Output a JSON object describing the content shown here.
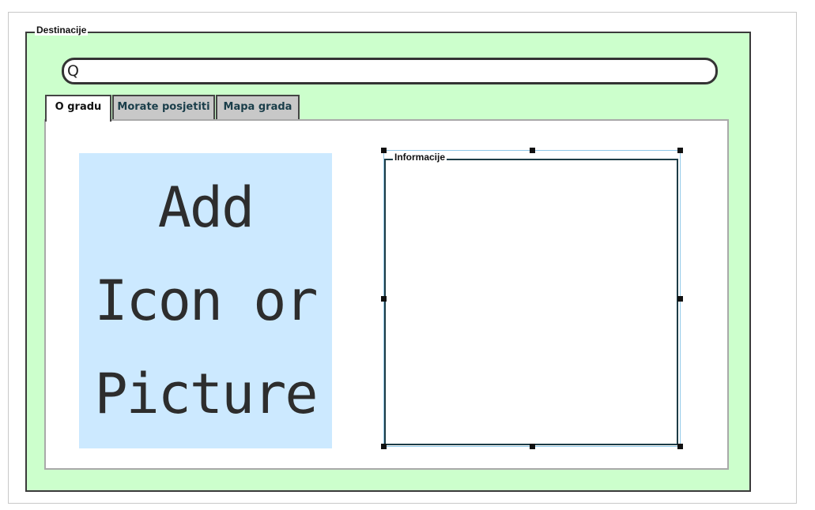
{
  "group": {
    "title": "Destinacije"
  },
  "search": {
    "icon": "search-icon",
    "glyph": "Q",
    "value": ""
  },
  "tabs": [
    {
      "label": "O gradu",
      "active": true
    },
    {
      "label": "Morate posjetiti",
      "active": false
    },
    {
      "label": "Mapa grada",
      "active": false
    }
  ],
  "image_placeholder": {
    "lines": [
      "Add",
      "Icon or",
      "Picture"
    ]
  },
  "info_panel": {
    "title": "Informacije"
  },
  "colors": {
    "group_background": "#ccffcc",
    "image_placeholder_background": "#cce9ff",
    "inactive_tab": "#c8c8c8",
    "info_border": "#1d3c46",
    "selection_outline": "#90c8e8"
  }
}
